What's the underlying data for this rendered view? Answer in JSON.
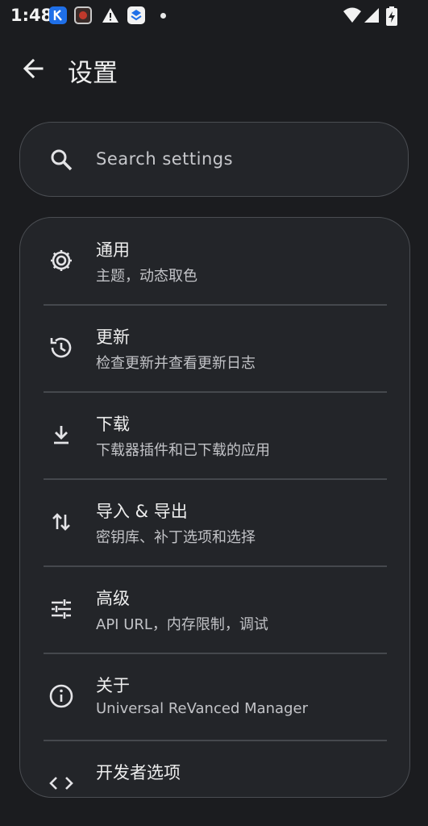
{
  "status_bar": {
    "time": "1:48"
  },
  "header": {
    "title": "设置"
  },
  "search": {
    "placeholder": "Search settings"
  },
  "menu": {
    "items": [
      {
        "title": "通用",
        "subtitle": "主题，动态取色",
        "icon": "gear-icon"
      },
      {
        "title": "更新",
        "subtitle": "检查更新并查看更新日志",
        "icon": "update-history-icon"
      },
      {
        "title": "下载",
        "subtitle": "下载器插件和已下载的应用",
        "icon": "download-icon"
      },
      {
        "title": "导入 & 导出",
        "subtitle": "密钥库、补丁选项和选择",
        "icon": "import-export-icon"
      },
      {
        "title": "高级",
        "subtitle": "API URL，内存限制，调试",
        "icon": "tune-icon"
      },
      {
        "title": "关于",
        "subtitle": "Universal ReVanced Manager",
        "icon": "info-icon"
      },
      {
        "title": "开发者选项",
        "subtitle": "",
        "icon": "developer-icon"
      }
    ]
  },
  "colors": {
    "background": "#1b1c1f",
    "card": "#232529",
    "border": "#4a4d52",
    "text": "#eeeeee",
    "subtext": "#c2c3c7"
  }
}
